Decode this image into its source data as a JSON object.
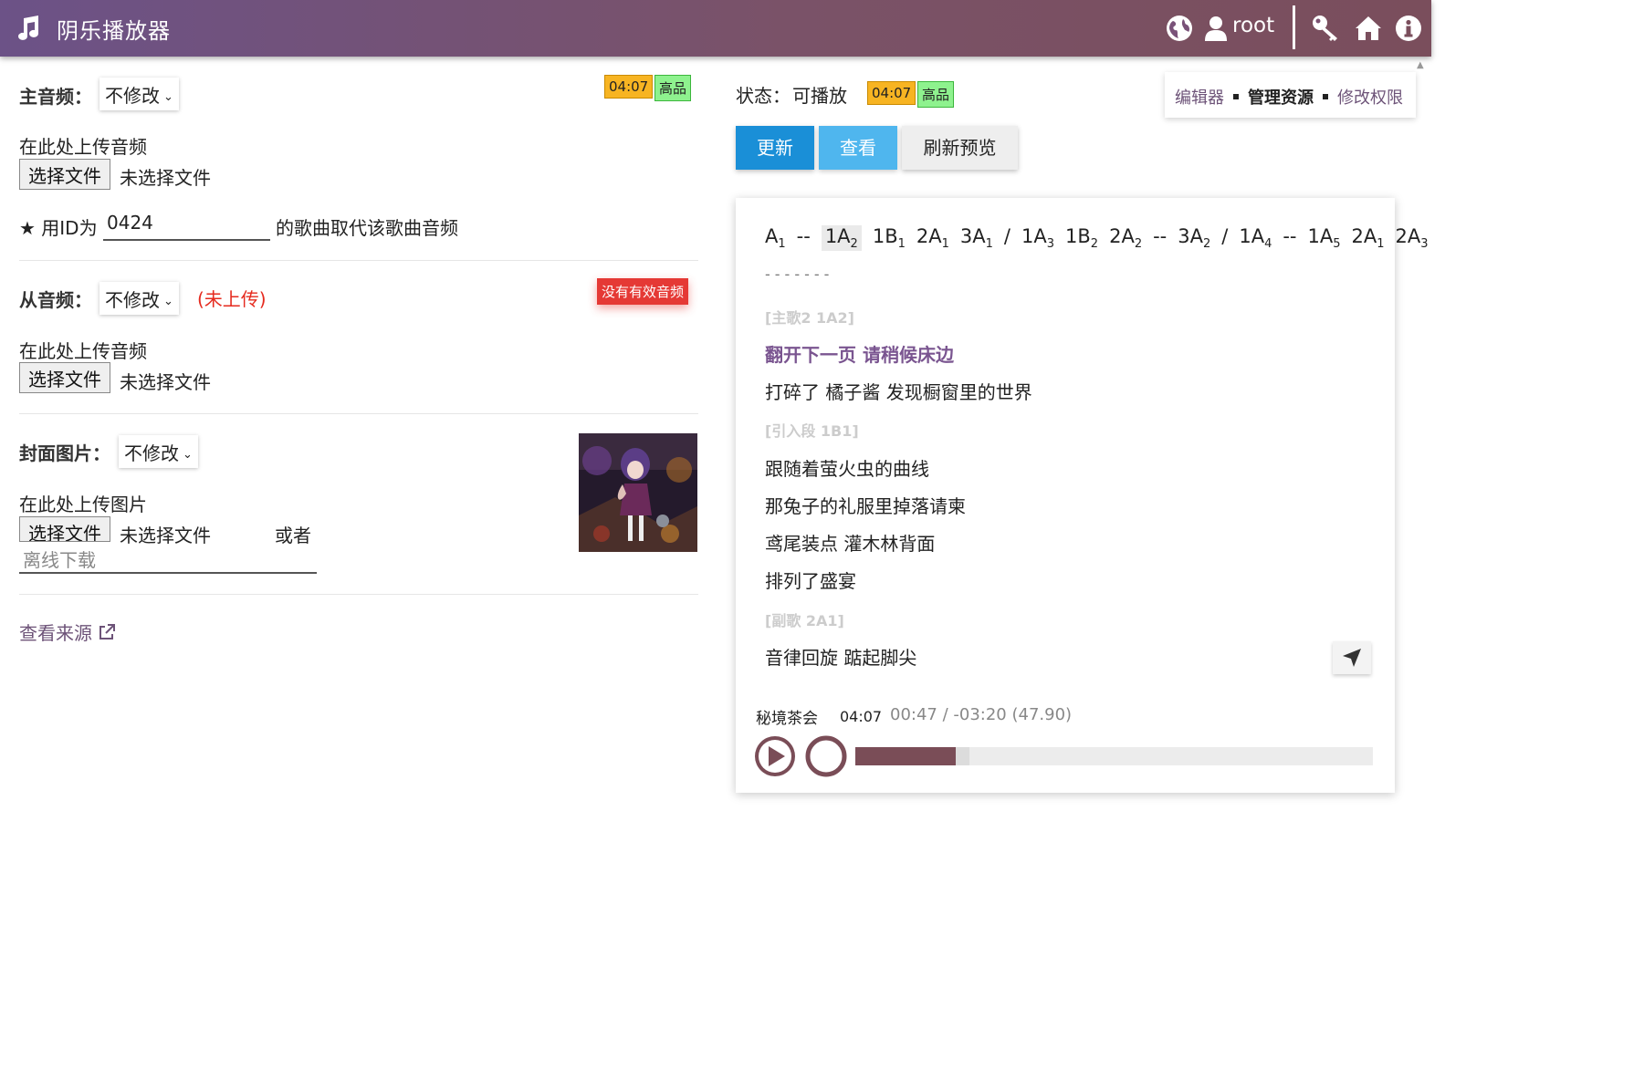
{
  "header": {
    "app_title": "阴乐播放器",
    "user_name": "root",
    "icons": [
      "music-note-icon",
      "globe-icon",
      "user-icon",
      "key-icon",
      "home-icon",
      "info-icon"
    ]
  },
  "main_audio": {
    "label": "主音频：",
    "select_value": "不修改",
    "duration_badge": "04:07",
    "quality_badge": "高品",
    "upload_prompt": "在此处上传音频",
    "file_button": "选择文件",
    "file_status": "未选择文件",
    "replace_prefix": "★ 用ID为",
    "replace_id_value": "0424",
    "replace_suffix": "的歌曲取代该歌曲音频"
  },
  "secondary_audio": {
    "label": "从音频：",
    "select_value": "不修改",
    "not_uploaded": "(未上传)",
    "no_audio_badge": "没有有效音频",
    "upload_prompt": "在此处上传音频",
    "file_button": "选择文件",
    "file_status": "未选择文件"
  },
  "cover": {
    "label": "封面图片：",
    "select_value": "不修改",
    "upload_prompt": "在此处上传图片",
    "file_button": "选择文件",
    "file_status": "未选择文件",
    "or_text": "或者",
    "offline_placeholder": "离线下载"
  },
  "source_link": "查看来源",
  "status": {
    "label": "状态：",
    "value": "可播放",
    "duration_badge": "04:07",
    "quality_badge": "高品"
  },
  "right_tabs": [
    "编辑器",
    "管理资源",
    "修改权限"
  ],
  "actions": {
    "update": "更新",
    "view": "查看",
    "refresh_preview": "刷新预览"
  },
  "sequence": {
    "tokens": [
      {
        "base": "A",
        "sub": "1"
      },
      {
        "base": "--",
        "sub": ""
      },
      {
        "base": "1A",
        "sub": "2"
      },
      {
        "base": "1B",
        "sub": "1"
      },
      {
        "base": "2A",
        "sub": "1"
      },
      {
        "base": "3A",
        "sub": "1"
      },
      {
        "base": "/",
        "sub": ""
      },
      {
        "base": "1A",
        "sub": "3"
      },
      {
        "base": "1B",
        "sub": "2"
      },
      {
        "base": "2A",
        "sub": "2"
      },
      {
        "base": "--",
        "sub": ""
      },
      {
        "base": "3A",
        "sub": "2"
      },
      {
        "base": "/",
        "sub": ""
      },
      {
        "base": "1A",
        "sub": "4"
      },
      {
        "base": "--",
        "sub": ""
      },
      {
        "base": "1A",
        "sub": "5"
      },
      {
        "base": "2A",
        "sub": "1"
      },
      {
        "base": "2A",
        "sub": "3"
      }
    ],
    "dashes": "-------"
  },
  "lyrics": {
    "section1": "[主歌2 1A2]",
    "line1_current": "翻开下一页 请稍候床边",
    "line2": "打碎了 橘子酱 发现橱窗里的世界",
    "section2": "[引入段 1B1]",
    "line3": "跟随着萤火虫的曲线",
    "line4": "那兔子的礼服里掉落请柬",
    "line5": "鸢尾装点 灌木林背面",
    "line6": "排列了盛宴",
    "section3": "[副歌 2A1]",
    "line7": "音律回旋 踮起脚尖"
  },
  "player": {
    "song_title": "秘境茶会",
    "length": "04:07",
    "position_text": "00:47 / -03:20 (47.90)",
    "progress_fraction": 0.194,
    "buffered_fraction": 0.22
  },
  "colors": {
    "header_start": "#6c5287",
    "header_end": "#7a4e5c",
    "accent_purple": "#7a5590",
    "primary_blue": "#1a8fd7",
    "progress": "#7a4d57",
    "error_red": "#e53935",
    "duration_badge": "#f7b422",
    "quality_badge": "#8ef28e"
  }
}
